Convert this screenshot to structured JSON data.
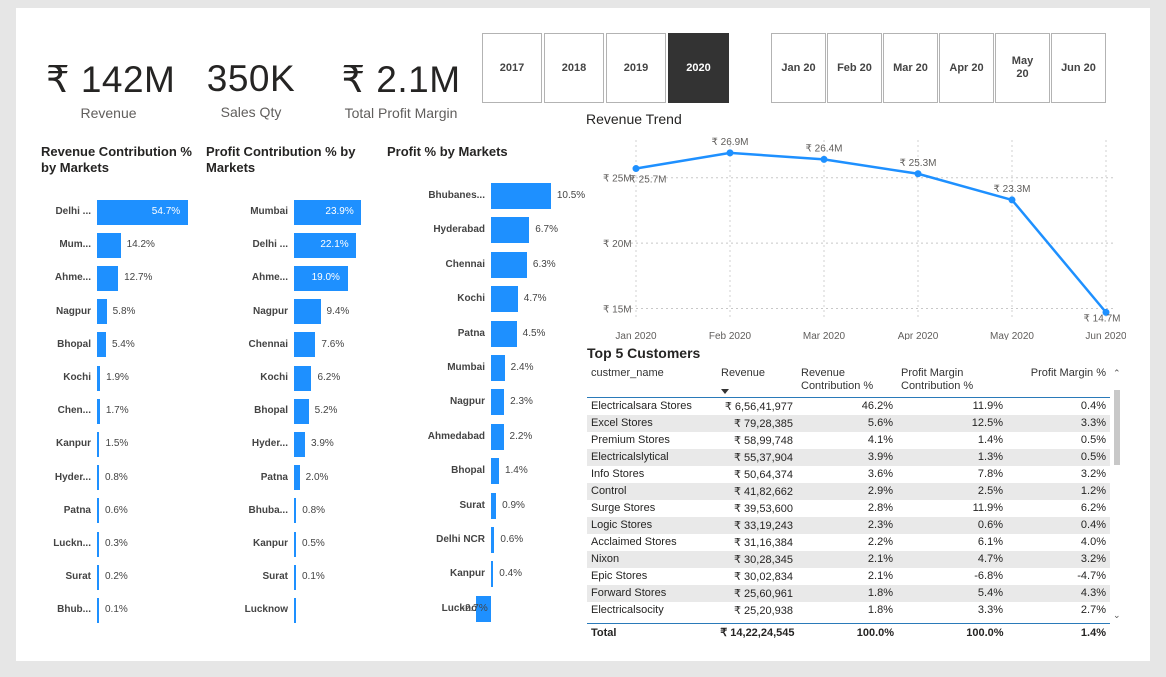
{
  "kpis": [
    {
      "value": "₹ 142M",
      "label": "Revenue"
    },
    {
      "value": "350K",
      "label": "Sales Qty"
    },
    {
      "value": "₹ 2.1M",
      "label": "Total Profit Margin"
    }
  ],
  "year_slicer": [
    {
      "label": "2017",
      "selected": false
    },
    {
      "label": "2018",
      "selected": false
    },
    {
      "label": "2019",
      "selected": false
    },
    {
      "label": "2020",
      "selected": true
    }
  ],
  "month_slicer": [
    {
      "label": "Jan 20"
    },
    {
      "label": "Feb 20"
    },
    {
      "label": "Mar 20"
    },
    {
      "label": "Apr 20"
    },
    {
      "label": "May 20"
    },
    {
      "label": "Jun 20"
    }
  ],
  "revenue_contribution": {
    "title": "Revenue Contribution % by Markets",
    "items": [
      {
        "label": "Delhi ...",
        "value": 54.7,
        "text": "54.7%"
      },
      {
        "label": "Mum...",
        "value": 14.2,
        "text": "14.2%"
      },
      {
        "label": "Ahme...",
        "value": 12.7,
        "text": "12.7%"
      },
      {
        "label": "Nagpur",
        "value": 5.8,
        "text": "5.8%"
      },
      {
        "label": "Bhopal",
        "value": 5.4,
        "text": "5.4%"
      },
      {
        "label": "Kochi",
        "value": 1.9,
        "text": "1.9%"
      },
      {
        "label": "Chen...",
        "value": 1.7,
        "text": "1.7%"
      },
      {
        "label": "Kanpur",
        "value": 1.5,
        "text": "1.5%"
      },
      {
        "label": "Hyder...",
        "value": 0.8,
        "text": "0.8%"
      },
      {
        "label": "Patna",
        "value": 0.6,
        "text": "0.6%"
      },
      {
        "label": "Luckn...",
        "value": 0.3,
        "text": "0.3%"
      },
      {
        "label": "Surat",
        "value": 0.2,
        "text": "0.2%"
      },
      {
        "label": "Bhub...",
        "value": 0.1,
        "text": "0.1%"
      }
    ]
  },
  "profit_contribution": {
    "title": "Profit Contribution % by Markets",
    "items": [
      {
        "label": "Mumbai",
        "value": 23.9,
        "text": "23.9%"
      },
      {
        "label": "Delhi ...",
        "value": 22.1,
        "text": "22.1%"
      },
      {
        "label": "Ahme...",
        "value": 19.0,
        "text": "19.0%"
      },
      {
        "label": "Nagpur",
        "value": 9.4,
        "text": "9.4%"
      },
      {
        "label": "Chennai",
        "value": 7.6,
        "text": "7.6%"
      },
      {
        "label": "Kochi",
        "value": 6.2,
        "text": "6.2%"
      },
      {
        "label": "Bhopal",
        "value": 5.2,
        "text": "5.2%"
      },
      {
        "label": "Hyder...",
        "value": 3.9,
        "text": "3.9%"
      },
      {
        "label": "Patna",
        "value": 2.0,
        "text": "2.0%"
      },
      {
        "label": "Bhuba...",
        "value": 0.8,
        "text": "0.8%"
      },
      {
        "label": "Kanpur",
        "value": 0.5,
        "text": "0.5%"
      },
      {
        "label": "Surat",
        "value": 0.1,
        "text": "0.1%"
      },
      {
        "label": "Lucknow",
        "value": 0,
        "text": ""
      }
    ]
  },
  "profit_pct": {
    "title": "Profit % by Markets",
    "items": [
      {
        "label": "Bhubanes...",
        "value": 10.5,
        "text": "10.5%"
      },
      {
        "label": "Hyderabad",
        "value": 6.7,
        "text": "6.7%"
      },
      {
        "label": "Chennai",
        "value": 6.3,
        "text": "6.3%"
      },
      {
        "label": "Kochi",
        "value": 4.7,
        "text": "4.7%"
      },
      {
        "label": "Patna",
        "value": 4.5,
        "text": "4.5%"
      },
      {
        "label": "Mumbai",
        "value": 2.4,
        "text": "2.4%"
      },
      {
        "label": "Nagpur",
        "value": 2.3,
        "text": "2.3%"
      },
      {
        "label": "Ahmedabad",
        "value": 2.2,
        "text": "2.2%"
      },
      {
        "label": "Bhopal",
        "value": 1.4,
        "text": "1.4%"
      },
      {
        "label": "Surat",
        "value": 0.9,
        "text": "0.9%"
      },
      {
        "label": "Delhi NCR",
        "value": 0.6,
        "text": "0.6%"
      },
      {
        "label": "Kanpur",
        "value": 0.4,
        "text": "0.4%"
      },
      {
        "label": "Lucknow",
        "value": -2.7,
        "text": "-2.7%"
      }
    ]
  },
  "chart_data": {
    "type": "line",
    "title": "Revenue Trend",
    "x": [
      "Jan 2020",
      "Feb 2020",
      "Mar 2020",
      "Apr 2020",
      "May 2020",
      "Jun 2020"
    ],
    "values": [
      25.7,
      26.9,
      26.4,
      25.3,
      23.3,
      14.7
    ],
    "labels": [
      "₹ 25.7M",
      "₹ 26.9M",
      "₹ 26.4M",
      "₹ 25.3M",
      "₹ 23.3M",
      "₹ 14.7M"
    ],
    "yticks": [
      {
        "value": 15,
        "label": "₹ 15M"
      },
      {
        "value": 20,
        "label": "₹ 20M"
      },
      {
        "value": 25,
        "label": "₹ 25M"
      }
    ],
    "ylim": [
      14.5,
      27.5
    ],
    "grid": true,
    "color": "#1e90ff"
  },
  "customers": {
    "title": "Top 5 Customers",
    "columns": [
      "custmer_name",
      "Revenue",
      "Revenue Contribution %",
      "Profit Margin Contribution %",
      "Profit Margin %"
    ],
    "rows": [
      [
        "Electricalsara Stores",
        "₹ 6,56,41,977",
        "46.2%",
        "11.9%",
        "0.4%"
      ],
      [
        "Excel Stores",
        "₹ 79,28,385",
        "5.6%",
        "12.5%",
        "3.3%"
      ],
      [
        "Premium Stores",
        "₹ 58,99,748",
        "4.1%",
        "1.4%",
        "0.5%"
      ],
      [
        "Electricalslytical",
        "₹ 55,37,904",
        "3.9%",
        "1.3%",
        "0.5%"
      ],
      [
        "Info Stores",
        "₹ 50,64,374",
        "3.6%",
        "7.8%",
        "3.2%"
      ],
      [
        "Control",
        "₹ 41,82,662",
        "2.9%",
        "2.5%",
        "1.2%"
      ],
      [
        "Surge Stores",
        "₹ 39,53,600",
        "2.8%",
        "11.9%",
        "6.2%"
      ],
      [
        "Logic Stores",
        "₹ 33,19,243",
        "2.3%",
        "0.6%",
        "0.4%"
      ],
      [
        "Acclaimed Stores",
        "₹ 31,16,384",
        "2.2%",
        "6.1%",
        "4.0%"
      ],
      [
        "Nixon",
        "₹ 30,28,345",
        "2.1%",
        "4.7%",
        "3.2%"
      ],
      [
        "Epic Stores",
        "₹ 30,02,834",
        "2.1%",
        "-6.8%",
        "-4.7%"
      ],
      [
        "Forward Stores",
        "₹ 25,60,961",
        "1.8%",
        "5.4%",
        "4.3%"
      ],
      [
        "Electricalsocity",
        "₹ 25,20,938",
        "1.8%",
        "3.3%",
        "2.7%"
      ]
    ],
    "total": [
      "Total",
      "₹ 14,22,24,545",
      "100.0%",
      "100.0%",
      "1.4%"
    ]
  },
  "colors": {
    "accent": "#1e90ff",
    "selected": "#333333"
  }
}
